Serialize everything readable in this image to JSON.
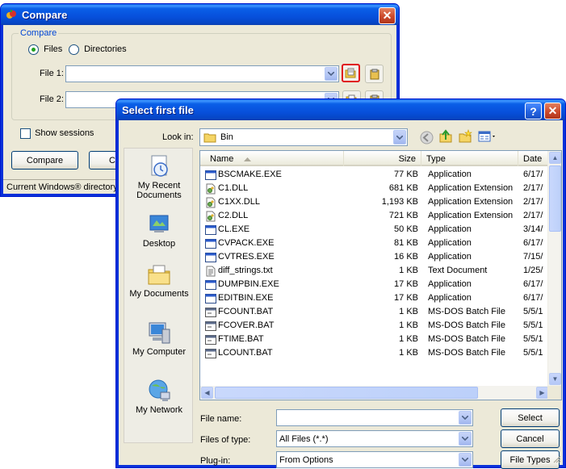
{
  "compare": {
    "title": "Compare",
    "group_label": "Compare",
    "radio_files": "Files",
    "radio_directories": "Directories",
    "file1_label": "File 1:",
    "file2_label": "File 2:",
    "file1_value": "",
    "file2_value": "",
    "show_sessions": "Show sessions",
    "compare_button": "Compare",
    "second_button_partial": "C",
    "status_text": "Current Windows® directory"
  },
  "dialog": {
    "title": "Select first file",
    "look_in_label": "Look in:",
    "look_in_value": "Bin",
    "columns": {
      "name": "Name",
      "size": "Size",
      "type": "Type",
      "date": "Date"
    },
    "files": [
      {
        "name": "BSCMAKE.EXE",
        "size": "77 KB",
        "type": "Application",
        "date": "6/17/",
        "icon": "exe-icon"
      },
      {
        "name": "C1.DLL",
        "size": "681 KB",
        "type": "Application Extension",
        "date": "2/17/",
        "icon": "dll-icon"
      },
      {
        "name": "C1XX.DLL",
        "size": "1,193 KB",
        "type": "Application Extension",
        "date": "2/17/",
        "icon": "dll-icon"
      },
      {
        "name": "C2.DLL",
        "size": "721 KB",
        "type": "Application Extension",
        "date": "2/17/",
        "icon": "dll-icon"
      },
      {
        "name": "CL.EXE",
        "size": "50 KB",
        "type": "Application",
        "date": "3/14/",
        "icon": "exe-icon"
      },
      {
        "name": "CVPACK.EXE",
        "size": "81 KB",
        "type": "Application",
        "date": "6/17/",
        "icon": "exe-icon"
      },
      {
        "name": "CVTRES.EXE",
        "size": "16 KB",
        "type": "Application",
        "date": "7/15/",
        "icon": "exe-icon"
      },
      {
        "name": "diff_strings.txt",
        "size": "1 KB",
        "type": "Text Document",
        "date": "1/25/",
        "icon": "txt-icon"
      },
      {
        "name": "DUMPBIN.EXE",
        "size": "17 KB",
        "type": "Application",
        "date": "6/17/",
        "icon": "exe-icon"
      },
      {
        "name": "EDITBIN.EXE",
        "size": "17 KB",
        "type": "Application",
        "date": "6/17/",
        "icon": "exe-icon"
      },
      {
        "name": "FCOUNT.BAT",
        "size": "1 KB",
        "type": "MS-DOS Batch File",
        "date": "5/5/1",
        "icon": "bat-icon"
      },
      {
        "name": "FCOVER.BAT",
        "size": "1 KB",
        "type": "MS-DOS Batch File",
        "date": "5/5/1",
        "icon": "bat-icon"
      },
      {
        "name": "FTIME.BAT",
        "size": "1 KB",
        "type": "MS-DOS Batch File",
        "date": "5/5/1",
        "icon": "bat-icon"
      },
      {
        "name": "LCOUNT.BAT",
        "size": "1 KB",
        "type": "MS-DOS Batch File",
        "date": "5/5/1",
        "icon": "bat-icon"
      }
    ],
    "places": [
      {
        "label": "My Recent Documents",
        "icon": "recent-documents-icon"
      },
      {
        "label": "Desktop",
        "icon": "desktop-icon"
      },
      {
        "label": "My Documents",
        "icon": "my-documents-icon"
      },
      {
        "label": "My Computer",
        "icon": "my-computer-icon"
      },
      {
        "label": "My Network",
        "icon": "my-network-icon"
      }
    ],
    "file_name_label": "File name:",
    "file_name_value": "",
    "files_of_type_label": "Files of type:",
    "files_of_type_value": "All Files (*.*)",
    "plugin_label": "Plug-in:",
    "plugin_value": "From Options",
    "select_button": "Select",
    "cancel_button": "Cancel",
    "file_types_button": "File Types",
    "help_button": "?",
    "close_button": "✕"
  },
  "colors": {
    "titlebar": "#0a5fe7",
    "dialog_bg": "#ece9d8",
    "focus_outline": "#e0141c",
    "group_legend": "#0046d5"
  }
}
